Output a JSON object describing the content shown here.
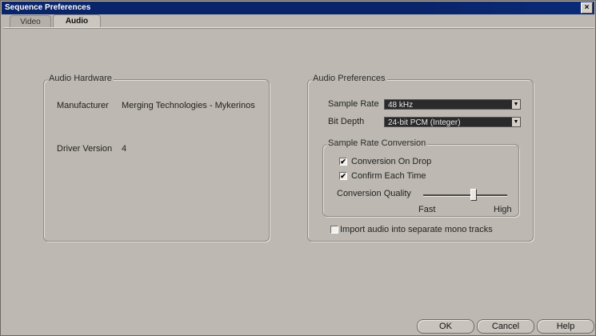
{
  "window": {
    "title": "Sequence Preferences",
    "close_label": "×"
  },
  "tabs": [
    {
      "label": "Video"
    },
    {
      "label": "Audio"
    }
  ],
  "audio_hardware": {
    "title": "Audio Hardware",
    "manufacturer_label": "Manufacturer",
    "manufacturer_value": "Merging Technologies - Mykerinos",
    "driver_version_label": "Driver Version",
    "driver_version_value": "4"
  },
  "audio_preferences": {
    "title": "Audio Preferences",
    "sample_rate_label": "Sample Rate",
    "sample_rate_value": "48 kHz",
    "bit_depth_label": "Bit Depth",
    "bit_depth_value": "24-bit PCM (Integer)",
    "src": {
      "title": "Sample Rate Conversion",
      "conversion_on_drop": {
        "label": "Conversion On Drop",
        "checked": true
      },
      "confirm_each_time": {
        "label": "Confirm Each Time",
        "checked": true
      },
      "quality_label": "Conversion Quality",
      "quality_level": 0.6,
      "fast_label": "Fast",
      "high_label": "High"
    },
    "import_mono": {
      "label": "Import audio into separate mono tracks",
      "checked": false
    }
  },
  "buttons": {
    "ok": "OK",
    "cancel": "Cancel",
    "help": "Help"
  },
  "icons": {
    "dropdown": "chevron-down-icon",
    "check": "checkmark-icon"
  }
}
